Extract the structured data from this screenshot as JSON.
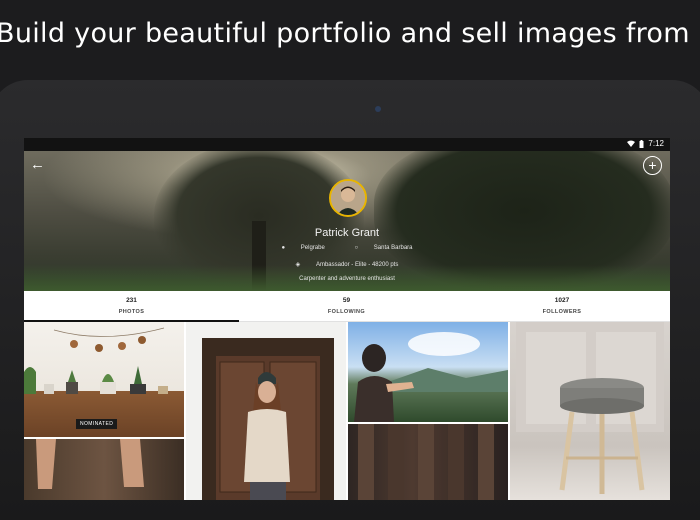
{
  "promo": {
    "headline": "Build your beautiful portfolio and sell images from it"
  },
  "statusbar": {
    "time": "7:12",
    "wifi_icon": "wifi-icon",
    "battery_icon": "battery-icon"
  },
  "header": {
    "back_icon": "arrow-left-icon",
    "add_icon": "plus-circle-icon",
    "add_symbol": "+",
    "back_symbol": "←"
  },
  "profile": {
    "name": "Patrick Grant",
    "pulse_label": "Pelgrabe",
    "location": "Santa Barbara",
    "status": "Ambassador - Elite - 48200 pts",
    "bio": "Carpenter and adventure enthusiast",
    "avatar_ring_color": "#e8b400"
  },
  "tabs": [
    {
      "count": "231",
      "label": "PHOTOS"
    },
    {
      "count": "59",
      "label": "FOLLOWING"
    },
    {
      "count": "1027",
      "label": "FOLLOWERS"
    }
  ],
  "photos": {
    "badge": "NOMINATED"
  },
  "colors": {
    "accent": "#e8b400",
    "background": "#1c1c1e"
  }
}
